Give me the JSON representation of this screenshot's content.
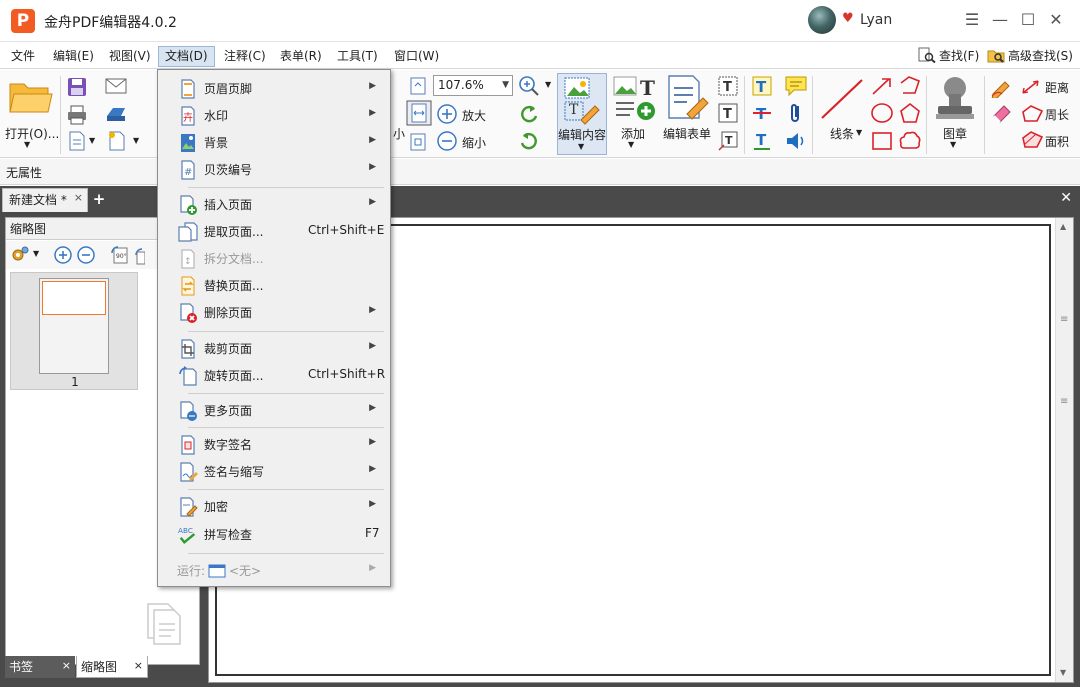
{
  "window": {
    "title": "金舟PDF编辑器4.0.2",
    "logo_letter": "P",
    "user_name": "Lyan",
    "controls": [
      "☰",
      "—",
      "☐",
      "✕"
    ]
  },
  "menubar": {
    "items": [
      "文件",
      "编辑(E)",
      "视图(V)",
      "文档(D)",
      "注释(C)",
      "表单(R)",
      "工具(T)",
      "窗口(W)"
    ],
    "find_label": "查找(F)",
    "advanced_find_label": "高级查找(S)"
  },
  "toolbar": {
    "open_label": "打开(O)...",
    "zoom_value": "107.6%",
    "zoom_in_label": "放大",
    "zoom_out_label": "缩小",
    "small_label": "小",
    "edit_content_label": "编辑内容",
    "add_label": "添加",
    "edit_form_label": "编辑表单",
    "line_label": "线条",
    "stamp_label": "图章",
    "distance_label": "距离",
    "perimeter_label": "周长",
    "area_label": "面积"
  },
  "propbar": {
    "text": "无属性"
  },
  "doc_tabs": {
    "active_tab": "新建文档 *",
    "close": "×",
    "add": "+"
  },
  "left_panel": {
    "title": "缩略图",
    "thumb_number": "1",
    "bottom_tabs": [
      "书签",
      "缩略图"
    ]
  },
  "document_menu": {
    "items": [
      {
        "label": "页眉页脚",
        "shortcut": "",
        "submenu": true,
        "disabled": false,
        "icon": "header-footer-icon"
      },
      {
        "label": "水印",
        "shortcut": "",
        "submenu": true,
        "disabled": false,
        "icon": "watermark-icon"
      },
      {
        "label": "背景",
        "shortcut": "",
        "submenu": true,
        "disabled": false,
        "icon": "background-icon"
      },
      {
        "label": "贝茨编号",
        "shortcut": "",
        "submenu": true,
        "disabled": false,
        "icon": "bates-number-icon"
      },
      {
        "label": "插入页面",
        "shortcut": "",
        "submenu": true,
        "disabled": false,
        "icon": "insert-page-icon"
      },
      {
        "label": "提取页面...",
        "shortcut": "Ctrl+Shift+E",
        "submenu": false,
        "disabled": false,
        "icon": "extract-page-icon"
      },
      {
        "label": "拆分文档...",
        "shortcut": "",
        "submenu": false,
        "disabled": true,
        "icon": "split-document-icon"
      },
      {
        "label": "替换页面...",
        "shortcut": "",
        "submenu": false,
        "disabled": false,
        "icon": "replace-page-icon"
      },
      {
        "label": "删除页面",
        "shortcut": "",
        "submenu": true,
        "disabled": false,
        "icon": "delete-page-icon"
      },
      {
        "label": "裁剪页面",
        "shortcut": "",
        "submenu": true,
        "disabled": false,
        "icon": "crop-page-icon"
      },
      {
        "label": "旋转页面...",
        "shortcut": "Ctrl+Shift+R",
        "submenu": false,
        "disabled": false,
        "icon": "rotate-page-icon"
      },
      {
        "label": "更多页面",
        "shortcut": "",
        "submenu": true,
        "disabled": false,
        "icon": "more-pages-icon"
      },
      {
        "label": "数字签名",
        "shortcut": "",
        "submenu": true,
        "disabled": false,
        "icon": "digital-signature-icon"
      },
      {
        "label": "签名与缩写",
        "shortcut": "",
        "submenu": true,
        "disabled": false,
        "icon": "sign-initials-icon"
      },
      {
        "label": "加密",
        "shortcut": "",
        "submenu": true,
        "disabled": false,
        "icon": "encrypt-icon"
      },
      {
        "label": "拼写检查",
        "shortcut": "F7",
        "submenu": false,
        "disabled": false,
        "icon": "spell-check-icon"
      }
    ],
    "run_label": "运行:",
    "run_value": "<无>",
    "spell_icon_text": "ABC"
  },
  "colors": {
    "brand": "#f25b21",
    "workspace": "#4a4a4a",
    "menu_bg": "#f0f0f0",
    "active_menu": "#d9e4f2",
    "thumb_selection": "#f07a2a"
  }
}
